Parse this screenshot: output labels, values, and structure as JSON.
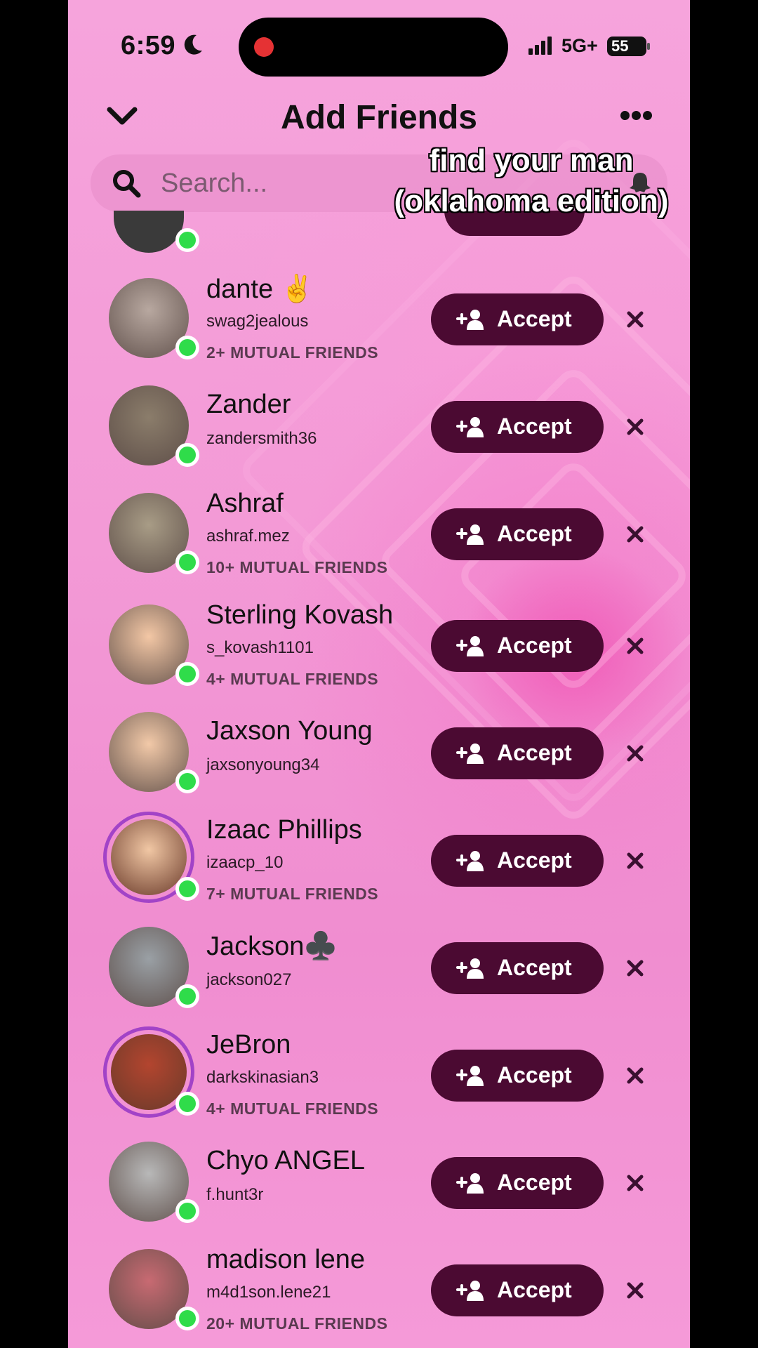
{
  "status_bar": {
    "time": "6:59",
    "network": "5G+",
    "battery": "55"
  },
  "header": {
    "title": "Add Friends"
  },
  "search": {
    "placeholder": "Search..."
  },
  "caption": {
    "line1": "find your man",
    "line2": "(oklahoma edition)"
  },
  "accept_label": "Accept",
  "requests": [
    {
      "name": "dante ✌️",
      "username": "swag2jealous",
      "mutual": "2+ MUTUAL FRIENDS",
      "avatar_color": "#b8a8a0",
      "ring": false
    },
    {
      "name": "Zander",
      "username": "zandersmith36",
      "mutual": "",
      "avatar_color": "#8b7d6b",
      "ring": false
    },
    {
      "name": "Ashraf",
      "username": "ashraf.mez",
      "mutual": "10+ MUTUAL FRIENDS",
      "avatar_color": "#a89c86",
      "ring": false
    },
    {
      "name": "Sterling Kovash",
      "username": "s_kovash1101",
      "mutual": "4+ MUTUAL FRIENDS",
      "avatar_color": "#f3c7a5",
      "ring": false
    },
    {
      "name": "Jaxson Young",
      "username": "jaxsonyoung34",
      "mutual": "",
      "avatar_color": "#f2c9a8",
      "ring": false
    },
    {
      "name": "Izaac Phillips",
      "username": "izaacp_10",
      "mutual": "7+ MUTUAL FRIENDS",
      "avatar_color": "#f1c7a4",
      "ring": true
    },
    {
      "name": "Jackson♣️",
      "username": "jackson027",
      "mutual": "",
      "avatar_color": "#9aa0a5",
      "ring": false
    },
    {
      "name": "JeBron",
      "username": "darkskinasian3",
      "mutual": "4+ MUTUAL FRIENDS",
      "avatar_color": "#b3452f",
      "ring": true
    },
    {
      "name": "Chyo ANGEL",
      "username": "f.hunt3r",
      "mutual": "",
      "avatar_color": "#b8b8b8",
      "ring": false
    },
    {
      "name": "madison lene",
      "username": "m4d1son.lene21",
      "mutual": "20+ MUTUAL FRIENDS",
      "avatar_color": "#c86a72",
      "ring": false
    }
  ],
  "icons": {
    "chevron": "chevron-down-icon",
    "more": "more-icon",
    "search": "search-icon",
    "add_friend": "add-friend-icon",
    "dismiss": "close-icon"
  }
}
